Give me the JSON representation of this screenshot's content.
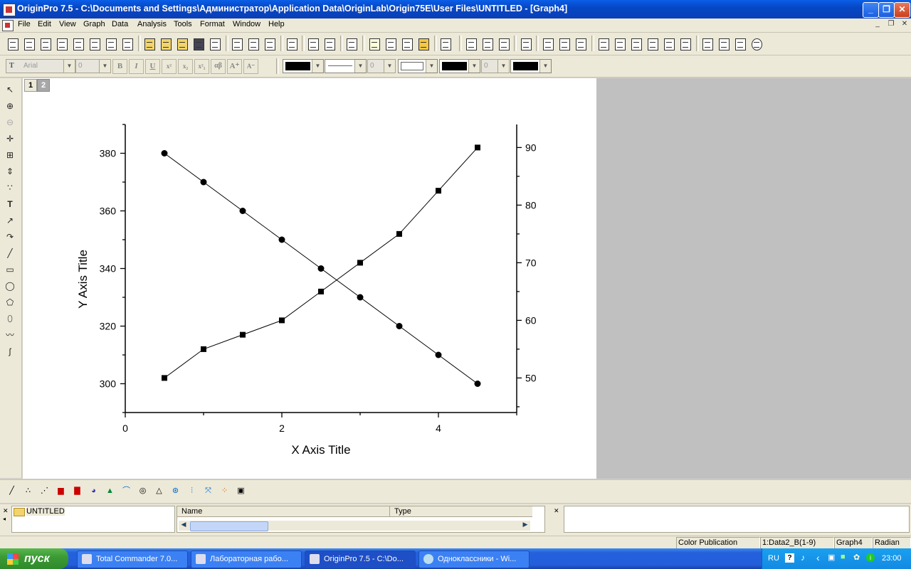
{
  "window": {
    "title": "OriginPro 7.5 - C:\\Documents and Settings\\Администратор\\Application Data\\OriginLab\\Origin75E\\User Files\\UNTITLED - [Graph4]"
  },
  "menu": [
    "File",
    "Edit",
    "View",
    "Graph",
    "Data",
    "Analysis",
    "Tools",
    "Format",
    "Window",
    "Help"
  ],
  "format_toolbar": {
    "font": "Arial",
    "size": "0",
    "line_width": "0",
    "symbol_size": "0"
  },
  "graph": {
    "layer_tabs": [
      "1",
      "2"
    ]
  },
  "chart_data": {
    "type": "line",
    "xlabel": "X Axis Title",
    "ylabel": "Y Axis Title",
    "xlim": [
      0,
      5
    ],
    "ylim_left": [
      290,
      390
    ],
    "ylim_right": [
      44,
      94
    ],
    "x_ticks": [
      "0",
      "2",
      "4"
    ],
    "y_left_ticks": [
      "300",
      "320",
      "340",
      "360",
      "380"
    ],
    "y_right_ticks": [
      "50",
      "60",
      "70",
      "80",
      "90"
    ],
    "grid": false,
    "series": [
      {
        "marker": "circle",
        "axis": "left",
        "x": [
          0.5,
          1,
          1.5,
          2,
          2.5,
          3,
          3.5,
          4,
          4.5
        ],
        "y": [
          380,
          370,
          360,
          350,
          340,
          330,
          320,
          310,
          300
        ]
      },
      {
        "marker": "square",
        "axis": "right",
        "x": [
          0.5,
          1,
          1.5,
          2,
          2.5,
          3,
          3.5,
          4,
          4.5
        ],
        "y": [
          50,
          55,
          57.5,
          60,
          65,
          70,
          75,
          82.5,
          90
        ]
      }
    ]
  },
  "explorer": {
    "folder": "UNTITLED",
    "col_name": "Name",
    "col_type": "Type"
  },
  "status": {
    "color_mode": "Color Publication",
    "active_data": "1:Data2_B(1-9)",
    "window": "Graph4",
    "angle_unit": "Radian"
  },
  "taskbar": {
    "start": "пуск",
    "tasks": [
      "Total Commander 7.0...",
      "Лабораторная рабо...",
      "OriginPro 7.5 - C:\\Do...",
      "Одноклассники - Wi..."
    ],
    "lang": "RU",
    "clock": "23:00"
  }
}
